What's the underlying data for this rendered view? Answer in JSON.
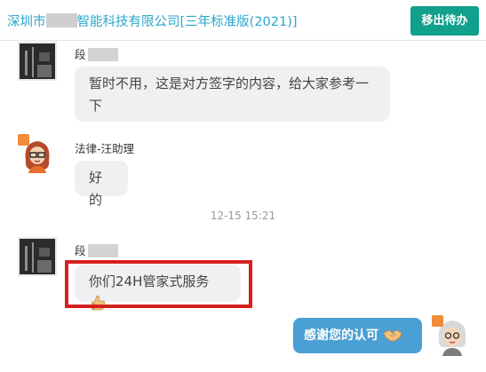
{
  "header": {
    "company_prefix": "深圳市",
    "company_suffix": "智能科技有限公司[三年标准版(2021)]",
    "move_button": "移出待办"
  },
  "messages": [
    {
      "sender": "段",
      "text": "暂时不用，这是对方签字的内容，给大家参考一下"
    },
    {
      "sender": "法律-汪助理",
      "text": "好的"
    },
    {
      "sender": "段",
      "text": "你们24H管家式服务"
    },
    {
      "text": "感谢您的认可"
    }
  ],
  "timestamp": "12-15 15:21",
  "colors": {
    "company_link": "#2aa7c9",
    "move_button_bg": "#10a08c",
    "highlight_border": "#d62020",
    "my_bubble_bg": "#4a9fd4",
    "their_bubble_bg": "#eef0f2"
  },
  "icons": [
    "thumbs-up-icon",
    "handshake-icon",
    "vip-badge-icon"
  ]
}
